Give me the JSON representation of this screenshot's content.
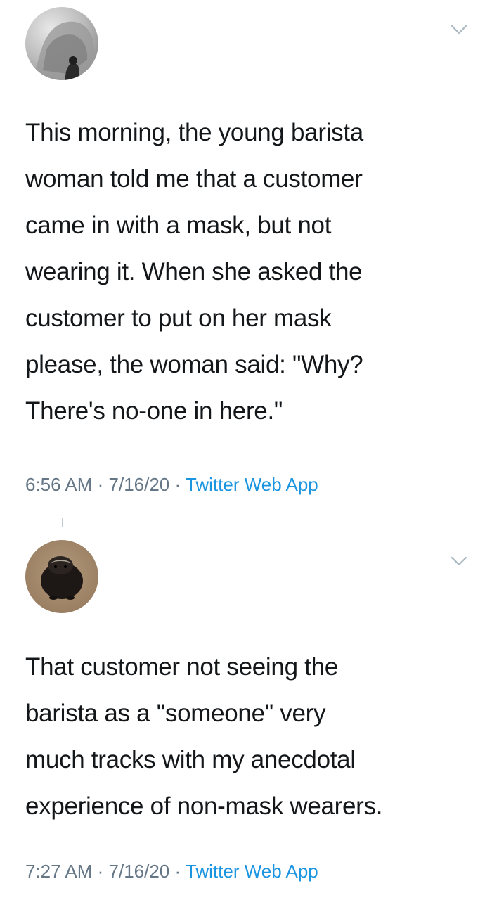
{
  "tweets": [
    {
      "avatar": "avatar-gray-landscape-icon",
      "text": "This morning, the young barista\nwoman told me that a customer\ncame in with a mask, but not\nwearing it. When she asked the\ncustomer to put on her mask\nplease, the woman said: \"Why?\nThere's no-one in here.\"",
      "time": "6:56 AM",
      "date": "7/16/20",
      "separator": " · ",
      "source": "Twitter Web App"
    },
    {
      "avatar": "avatar-honey-badger-icon",
      "text": "That customer not seeing the\nbarista as a \"someone\" very\nmuch tracks with my anecdotal\nexperience of non-mask wearers.",
      "time": "7:27 AM",
      "date": "7/16/20",
      "separator": " · ",
      "source": "Twitter Web App"
    }
  ],
  "colors": {
    "text": "#14171a",
    "meta": "#657786",
    "link": "#1b95e0",
    "chevron": "#aab8c2"
  }
}
